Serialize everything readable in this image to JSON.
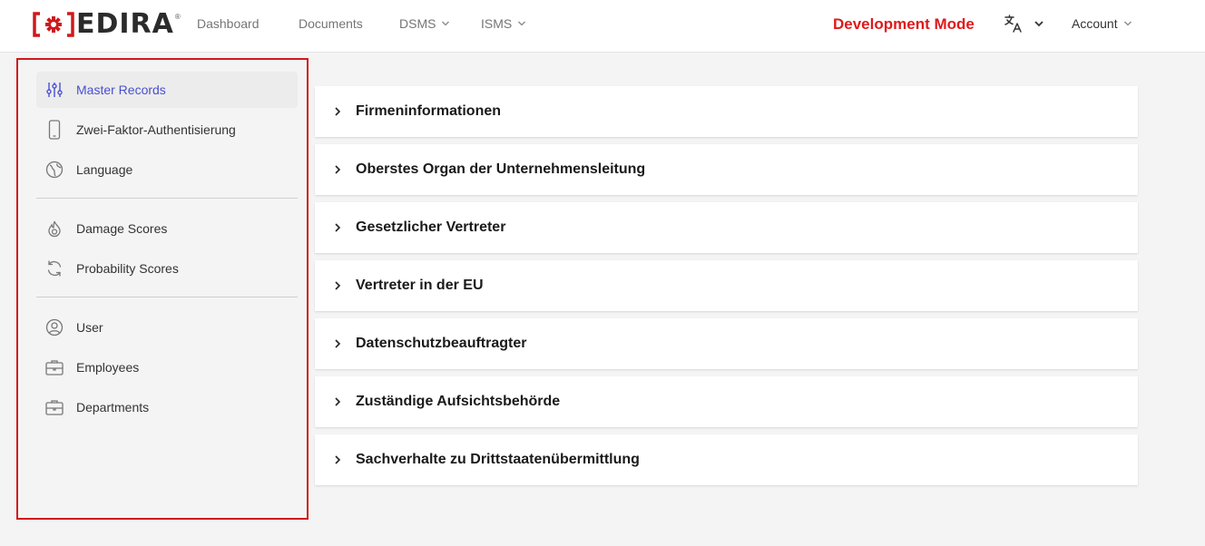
{
  "brand": {
    "name": "EDIRA",
    "registered": "®",
    "accent": "#d0181b"
  },
  "nav": {
    "dashboard": "Dashboard",
    "documents": "Documents",
    "dsms": "DSMS",
    "isms": "ISMS",
    "dev_mode": "Development Mode",
    "account": "Account"
  },
  "sidebar": {
    "items": [
      {
        "label": "Master Records",
        "icon": "sliders-icon",
        "active": true
      },
      {
        "label": "Zwei-Faktor-Authentisierung",
        "icon": "phone-icon"
      },
      {
        "label": "Language",
        "icon": "globe-icon"
      },
      {
        "label": "Damage Scores",
        "icon": "fire-icon"
      },
      {
        "label": "Probability Scores",
        "icon": "refresh-icon"
      },
      {
        "label": "User",
        "icon": "user-circle-icon"
      },
      {
        "label": "Employees",
        "icon": "briefcase-icon"
      },
      {
        "label": "Departments",
        "icon": "briefcase-icon"
      }
    ]
  },
  "sections": [
    {
      "label": "Firmeninformationen"
    },
    {
      "label": "Oberstes Organ der Unternehmensleitung"
    },
    {
      "label": "Gesetzlicher Vertreter"
    },
    {
      "label": "Vertreter in der EU"
    },
    {
      "label": "Datenschutzbeauftragter"
    },
    {
      "label": "Zuständige Aufsichtsbehörde"
    },
    {
      "label": "Sachverhalte zu Drittstaatenübermittlung"
    }
  ],
  "colors": {
    "dev_mode": "#e0191b",
    "active_link": "#4a4fd1",
    "highlight_border": "#d0181b"
  }
}
